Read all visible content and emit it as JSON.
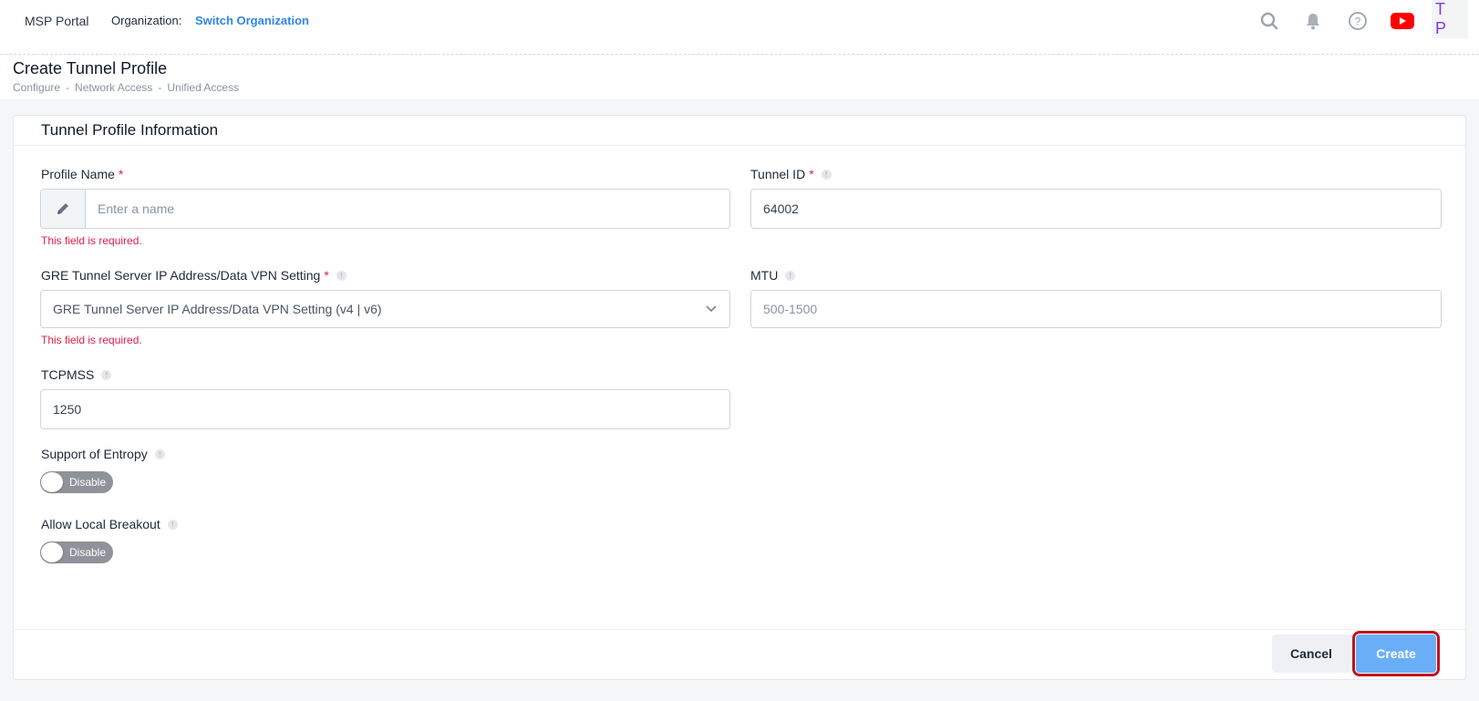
{
  "header": {
    "brand": "MSP Portal",
    "org_label": "Organization:",
    "org_link": "Switch Organization",
    "avatar_initials": "T P",
    "icons": [
      "search-icon",
      "bell-icon",
      "help-icon",
      "youtube-icon"
    ]
  },
  "page": {
    "title": "Create Tunnel Profile",
    "breadcrumb": [
      "Configure",
      "Network Access",
      "Unified Access"
    ],
    "breadcrumb_sep": "-"
  },
  "card": {
    "title": "Tunnel Profile Information"
  },
  "form": {
    "profile_name": {
      "label": "Profile Name",
      "required_mark": "*",
      "placeholder": "Enter a name",
      "value": "",
      "error": "This field is required."
    },
    "tunnel_id": {
      "label": "Tunnel ID",
      "required_mark": "*",
      "value": "64002"
    },
    "gre_server": {
      "label": "GRE Tunnel Server IP Address/Data VPN Setting",
      "required_mark": "*",
      "selected": "GRE Tunnel Server IP Address/Data VPN Setting  (v4 | v6)",
      "error": "This field is required."
    },
    "mtu": {
      "label": "MTU",
      "placeholder": "500-1500",
      "value": ""
    },
    "tcpmss": {
      "label": "TCPMSS",
      "value": "1250"
    },
    "entropy": {
      "label": "Support of Entropy",
      "state": "Disable"
    },
    "local_breakout": {
      "label": "Allow Local Breakout",
      "state": "Disable"
    }
  },
  "footer": {
    "cancel_label": "Cancel",
    "create_label": "Create"
  },
  "colors": {
    "accent": "#2f86e4",
    "error": "#e11d48",
    "create_button": "#6aaef8",
    "highlight": "#c0141f"
  }
}
